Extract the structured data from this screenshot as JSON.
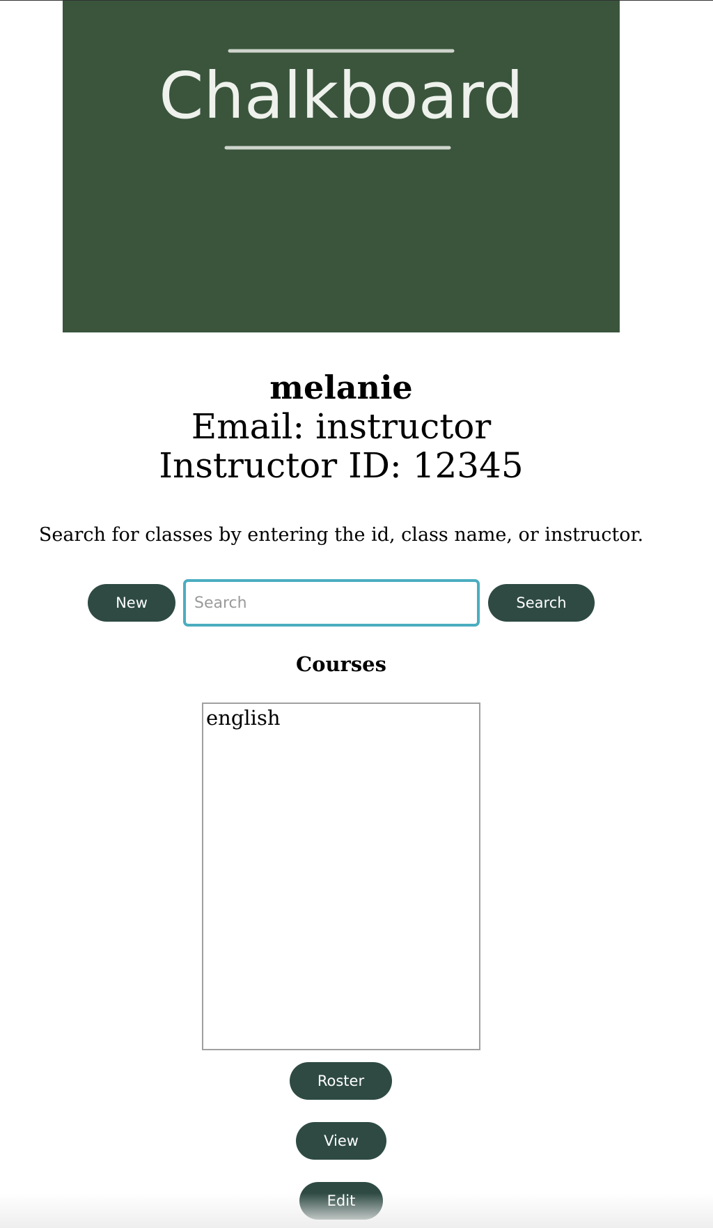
{
  "banner": {
    "logo_text": "Chalkboard",
    "background_color": "#3a553c"
  },
  "profile": {
    "name": "melanie",
    "email_line": "Email: instructor",
    "id_line": "Instructor ID: 12345"
  },
  "search": {
    "help_text": "Search for classes by entering the id, class name, or instructor.",
    "new_label": "New",
    "placeholder": "Search",
    "value": "",
    "search_label": "Search"
  },
  "courses": {
    "heading": "Courses",
    "items": [
      "english"
    ]
  },
  "actions": {
    "roster_label": "Roster",
    "view_label": "View",
    "edit_label": "Edit"
  },
  "colors": {
    "button": "#2e4a43",
    "input_focus_border": "#4badc0"
  }
}
